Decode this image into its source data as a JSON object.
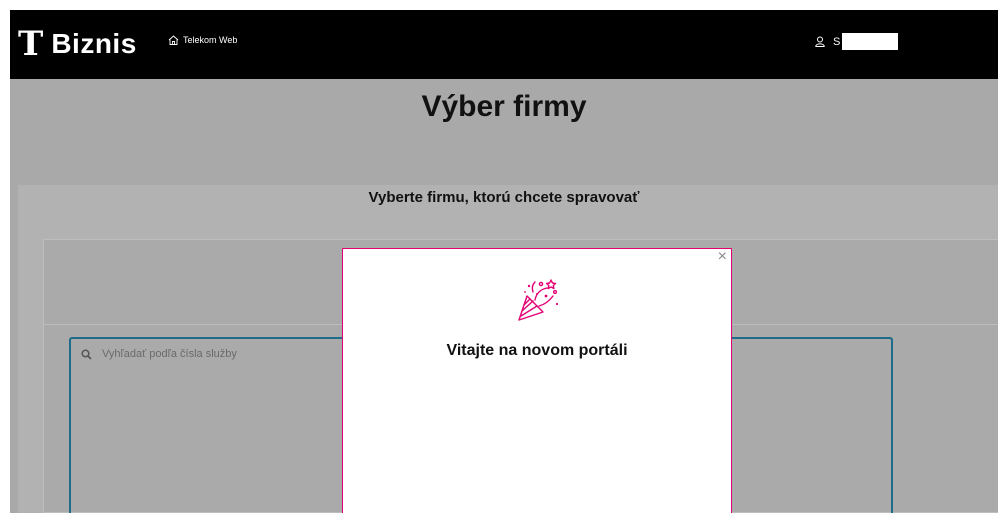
{
  "header": {
    "logo_mark": "T",
    "logo_text": "Biznis",
    "home_link_label": "Telekom Web",
    "user_initial": "S"
  },
  "page": {
    "title": "Výber firmy",
    "subtitle": "Vyberte firmu, ktorú chcete spravovať"
  },
  "search": {
    "placeholder": "Vyhľadať podľa čísla služby",
    "icon": "search-icon"
  },
  "modal": {
    "title": "Vitajte na novom portáli",
    "close_label": "×",
    "icon": "party-popper-icon"
  },
  "colors": {
    "brand": "#e20074",
    "header_bg": "#000000",
    "overlay": "#a9a9a9",
    "search_border": "#1f6c8a"
  }
}
